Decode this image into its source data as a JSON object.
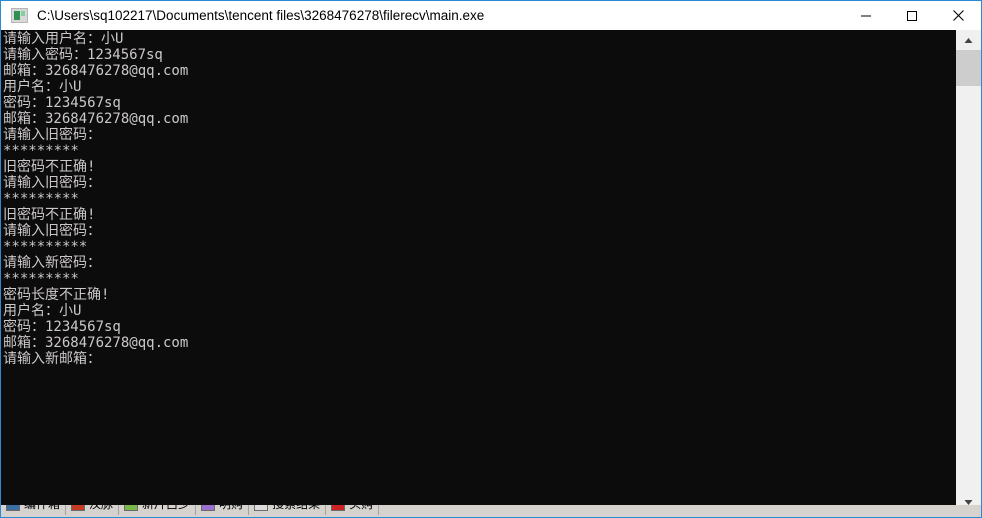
{
  "window": {
    "title": "C:\\Users\\sq102217\\Documents\\tencent files\\3268476278\\filerecv\\main.exe",
    "icon": "console-app-icon",
    "accent_border_color": "#2a8ad4",
    "titlebar_bg": "#ffffff",
    "controls": {
      "minimize_label": "–",
      "maximize_label": "□",
      "close_label": "×",
      "minimize_name": "minimize-icon",
      "maximize_name": "maximize-icon",
      "close_name": "close-icon"
    }
  },
  "console": {
    "background_color": "#0c0c0c",
    "foreground_color": "#ccc8c8",
    "lines": [
      "请输入用户名：小U",
      "请输入密码：1234567sq",
      "邮箱：3268476278@qq.com",
      "用户名：小U",
      "密码：1234567sq",
      "邮箱：3268476278@qq.com",
      "请输入旧密码：",
      "*********",
      "旧密码不正确!",
      "请输入旧密码：",
      "*********",
      "旧密码不正确!",
      "请输入旧密码：",
      "**********",
      "请输入新密码：",
      "*********",
      "密码长度不正确!",
      "用户名：小U",
      "密码：1234567sq",
      "邮箱：3268476278@qq.com",
      "请输入新邮箱："
    ]
  },
  "scrollbar": {
    "up_arrow": "▲",
    "down_arrow": "▼",
    "track_color": "#f0f0f0",
    "thumb_color": "#cdcdcd"
  },
  "taskbar": {
    "items": [
      {
        "label": "编件箱",
        "icon_color": "#3a6ea5"
      },
      {
        "label": "汉脉",
        "icon_color": "#c23b22"
      },
      {
        "label": "新片吕少",
        "icon_color": "#7ab648"
      },
      {
        "label": "明购",
        "icon_color": "#9b6fcf"
      },
      {
        "label": "搜索结果",
        "icon_color": "#dcdcdc"
      },
      {
        "label": "头购",
        "icon_color": "#cc2222"
      }
    ]
  }
}
